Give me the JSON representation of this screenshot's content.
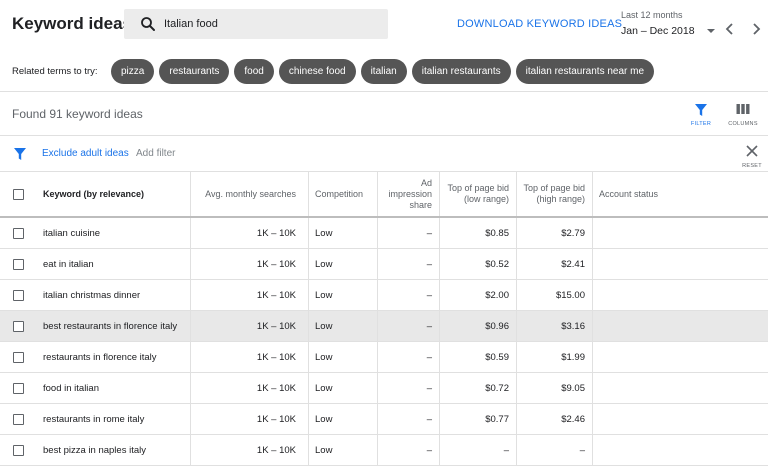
{
  "header": {
    "title": "Keyword ideas",
    "search_value": "Italian food",
    "download_label": "DOWNLOAD KEYWORD IDEAS",
    "date_label": "Last 12 months",
    "date_value": "Jan – Dec 2018"
  },
  "related": {
    "label": "Related terms to try:",
    "chips": [
      "pizza",
      "restaurants",
      "food",
      "chinese food",
      "italian",
      "italian restaurants",
      "italian restaurants near me"
    ]
  },
  "summary": {
    "found_text": "Found 91 keyword ideas",
    "filter_label": "FILTER",
    "columns_label": "COLUMNS"
  },
  "filters": {
    "exclude_label": "Exclude adult ideas",
    "add_label": "Add filter",
    "reset_label": "RESET"
  },
  "table": {
    "headers": {
      "keyword": "Keyword (by relevance)",
      "avg": "Avg. monthly searches",
      "competition": "Competition",
      "impression_line1": "Ad",
      "impression_line2": "impression",
      "impression_line3": "share",
      "low_line1": "Top of page bid",
      "low_line2": "(low range)",
      "high_line1": "Top of page bid",
      "high_line2": "(high range)",
      "account": "Account status"
    },
    "rows": [
      {
        "keyword": "italian cuisine",
        "avg": "1K – 10K",
        "competition": "Low",
        "impression": "–",
        "low": "$0.85",
        "high": "$2.79",
        "account": ""
      },
      {
        "keyword": "eat in italian",
        "avg": "1K – 10K",
        "competition": "Low",
        "impression": "–",
        "low": "$0.52",
        "high": "$2.41",
        "account": ""
      },
      {
        "keyword": "italian christmas dinner",
        "avg": "1K – 10K",
        "competition": "Low",
        "impression": "–",
        "low": "$2.00",
        "high": "$15.00",
        "account": ""
      },
      {
        "keyword": "best restaurants in florence italy",
        "avg": "1K – 10K",
        "competition": "Low",
        "impression": "–",
        "low": "$0.96",
        "high": "$3.16",
        "account": ""
      },
      {
        "keyword": "restaurants in florence italy",
        "avg": "1K – 10K",
        "competition": "Low",
        "impression": "–",
        "low": "$0.59",
        "high": "$1.99",
        "account": ""
      },
      {
        "keyword": "food in italian",
        "avg": "1K – 10K",
        "competition": "Low",
        "impression": "–",
        "low": "$0.72",
        "high": "$9.05",
        "account": ""
      },
      {
        "keyword": "restaurants in rome italy",
        "avg": "1K – 10K",
        "competition": "Low",
        "impression": "–",
        "low": "$0.77",
        "high": "$2.46",
        "account": ""
      },
      {
        "keyword": "best pizza in naples italy",
        "avg": "1K – 10K",
        "competition": "Low",
        "impression": "–",
        "low": "–",
        "high": "–",
        "account": ""
      }
    ]
  },
  "colors": {
    "accent": "#1a73e8",
    "chip_bg": "#555555",
    "row_highlight": "#e8e8e8"
  },
  "icons": {
    "search": "search-icon",
    "prev": "chevron-left-icon",
    "next": "chevron-right-icon",
    "filter": "filter-icon",
    "columns": "columns-icon",
    "reset": "close-icon"
  }
}
